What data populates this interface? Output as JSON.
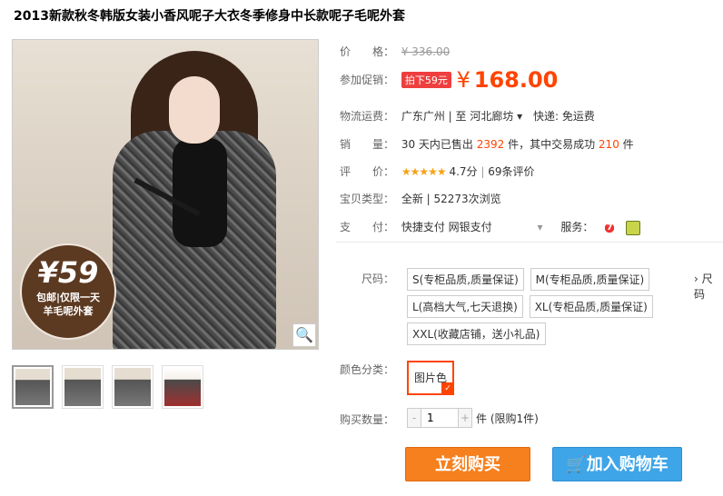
{
  "product": {
    "title": "2013新款秋冬韩版女装小香风呢子大衣冬季修身中长款呢子毛呢外套"
  },
  "gallery": {
    "badge_price": "¥59",
    "badge_line1": "包邮|仅限一天",
    "badge_line2": "羊毛呢外套",
    "zoom_icon": "magnifier-icon"
  },
  "price": {
    "label": "价　　格：",
    "original": "¥ 336.00"
  },
  "promo": {
    "label": "参加促销：",
    "tag": "拍下59元",
    "currency": "¥",
    "value": "168.00"
  },
  "shipping": {
    "label": "物流运费：",
    "route": "广东广州 | 至  河北廊坊 ▾",
    "fee": "快递: 免运费"
  },
  "sales": {
    "label": "销　　量：",
    "prefix": "30 天内已售出 ",
    "sold": "2392",
    "mid": " 件，其中交易成功 ",
    "success": "210",
    "suffix": " 件"
  },
  "rating": {
    "label": "评　　价：",
    "stars": "★★★★★",
    "score": "4.7分",
    "sep": " | ",
    "count": "69条评价"
  },
  "item_type": {
    "label": "宝贝类型：",
    "value": "全新  |  52273次浏览"
  },
  "payment": {
    "label": "支　　付：",
    "methods": "快捷支付  网银支付",
    "service_label": "服务：",
    "service_icon1": "seven-day-return-icon",
    "service_icon2": "guarantee-icon"
  },
  "size": {
    "label": "尺码：",
    "options": [
      "S(专柜品质,质量保证)",
      "M(专柜品质,质量保证)",
      "L(高档大气,七天退换)",
      "XL(专柜品质,质量保证)",
      "XXL(收藏店铺，送小礼品)"
    ],
    "more": "› 尺码"
  },
  "color": {
    "label": "颜色分类：",
    "selected": "图片色"
  },
  "quantity": {
    "label": "购买数量：",
    "value": "1",
    "minus": "-",
    "plus": "+",
    "limit": "件 (限购1件)"
  },
  "actions": {
    "buy_now": "立刻购买",
    "add_cart": "加入购物车"
  }
}
